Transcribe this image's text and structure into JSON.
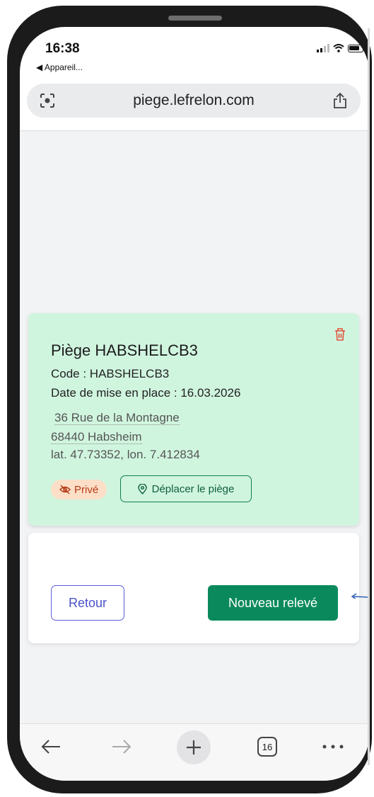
{
  "status": {
    "time": "16:38",
    "back_app": "◀ Appareil..."
  },
  "browser": {
    "url": "piege.lefrelon.com",
    "tab_count": "16"
  },
  "trap": {
    "title": "Piège HABSHELCB3",
    "code": "Code : HABSHELCB3",
    "date": "Date de mise en place : 16.03.2026",
    "address_line1": "36 Rue de la Montagne",
    "address_line2": "68440 Habsheim",
    "coords": "lat. 47.73352, lon. 7.412834",
    "privacy_badge": "Privé",
    "move_button": "Déplacer le piège"
  },
  "actions": {
    "back_button": "Retour",
    "new_reading_button": "Nouveau relevé"
  },
  "colors": {
    "card_bg": "#d0f5df",
    "primary": "#0a8a5c",
    "back_border": "#5b5fd8",
    "badge_bg": "#fddfc8"
  }
}
